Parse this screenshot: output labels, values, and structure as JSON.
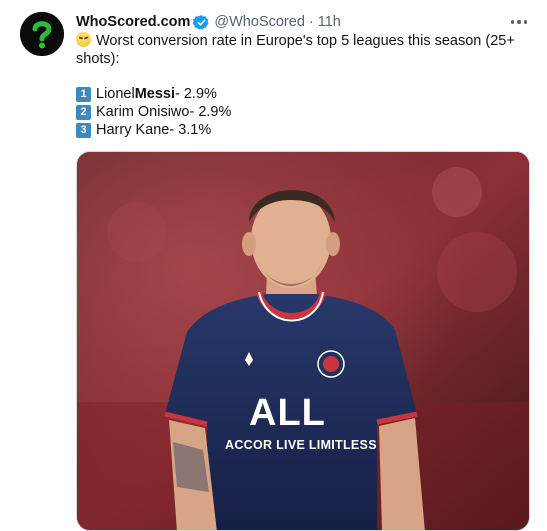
{
  "tweet": {
    "display_name": "WhoScored.com",
    "handle": "@WhoScored",
    "separator": "·",
    "time": "11h",
    "text": "Worst conversion rate in Europe's top 5 leagues this season (25+ shots):",
    "list": [
      {
        "rank": "1",
        "first": "Lionel ",
        "last": "Messi",
        "value": " - 2.9%"
      },
      {
        "rank": "2",
        "first": "Karim Onisiwo",
        "last": "",
        "value": " - 2.9%"
      },
      {
        "rank": "3",
        "first": "Harry Kane",
        "last": "",
        "value": " - 3.1%"
      }
    ],
    "media": {
      "jersey_main": "ALL",
      "jersey_sub": "ACCOR LIVE LIMITLESS"
    }
  },
  "icons": {
    "avatar": "whoscored-logo",
    "verified": "verified-badge-icon",
    "more": "more-horizontal-icon",
    "emoji": "persevering-face-emoji"
  },
  "colors": {
    "verified_blue": "#1d9bf0",
    "keycap_blue": "#3b88c3",
    "secondary_text": "#536471",
    "logo_green": "#2ebd3b"
  }
}
